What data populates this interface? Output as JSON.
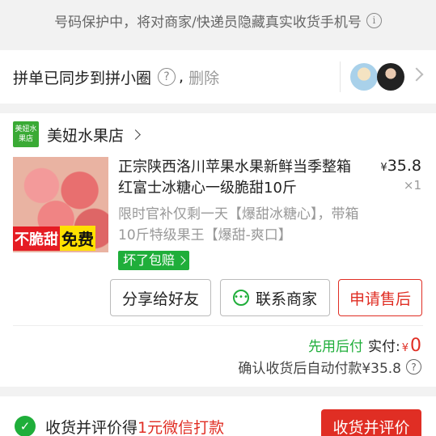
{
  "privacy_notice": {
    "text": "号码保护中，将对商家/快递员隐藏真实收货手机号",
    "icon": "info-icon"
  },
  "group_sync": {
    "text": "拼单已同步到拼小圈",
    "comma": ",",
    "delete_label": "删除"
  },
  "shop": {
    "logo_text": "美妞水果店",
    "name": "美妞水果店"
  },
  "product": {
    "image_text_1": "不脆甜",
    "image_text_2": "免费",
    "title": "正宗陕西洛川苹果水果新鲜当季整箱红富士冰糖心一级脆甜10斤",
    "price_currency": "¥",
    "price_value": "35.8",
    "quantity": "×1",
    "promo": "限时官补仅剩一天【爆甜冰糖心】，带箱10斤特级果王【爆甜-爽口】",
    "badge": "坏了包赔"
  },
  "actions": {
    "share": "分享给好友",
    "contact": "联系商家",
    "refund": "申请售后"
  },
  "payment": {
    "pay_later": "先用后付",
    "paid_label": "实付:",
    "paid_currency": "¥",
    "paid_value": "0",
    "auto_pay": "确认收货后自动付款¥35.8"
  },
  "bottom_bar": {
    "text_prefix": "收货并评价得",
    "text_highlight": "1元微信打款",
    "button": "收货并评价"
  },
  "colors": {
    "brand_red": "#e02e24",
    "brand_green": "#1fae3a"
  }
}
